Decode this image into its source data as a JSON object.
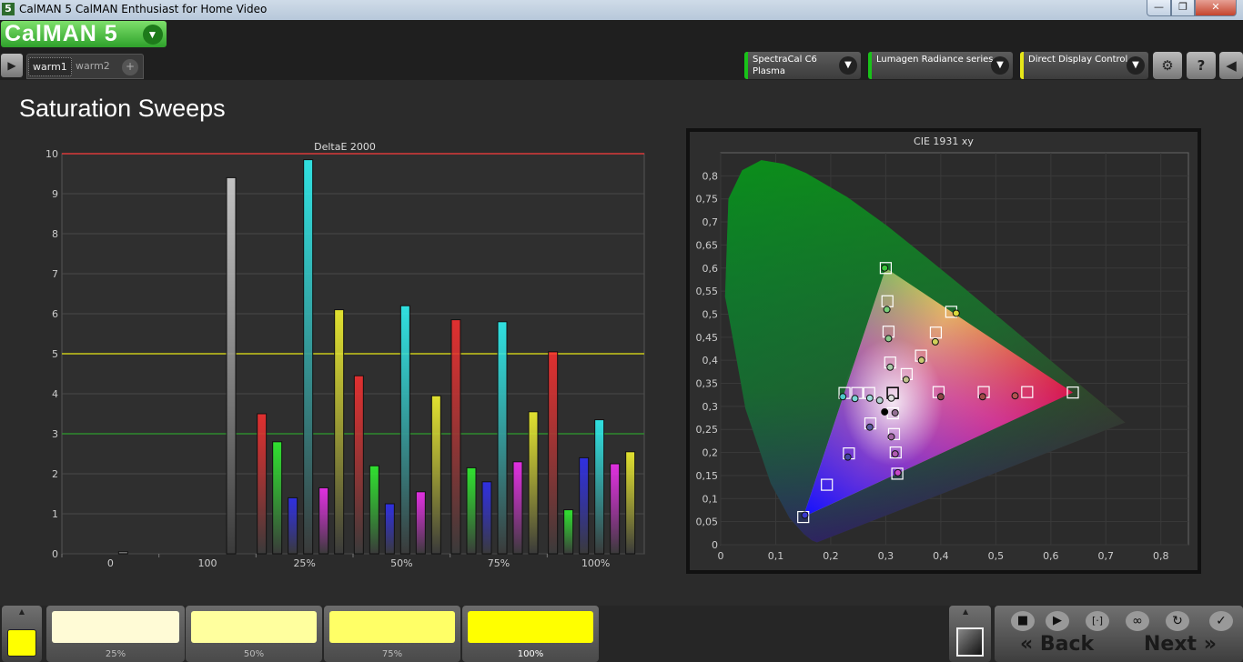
{
  "window": {
    "title": "CalMAN 5 CalMAN Enthusiast for Home Video",
    "minimize": "—",
    "maximize": "❐",
    "close": "✕"
  },
  "app": {
    "logo": "CalMAN 5",
    "tabs": [
      "warm1",
      "warm2"
    ],
    "add_tab": "+"
  },
  "devices": [
    {
      "line1": "SpectraCal C6",
      "line2": "Plasma",
      "color": "#19c219"
    },
    {
      "line1": "Lumagen Radiance series",
      "line2": "",
      "color": "#19c219"
    },
    {
      "line1": "Direct Display Control",
      "line2": "",
      "color": "#e6e619"
    }
  ],
  "toolbar_icons": [
    "gear-icon",
    "help-icon",
    "collapse-icon"
  ],
  "page": {
    "title": "Saturation Sweeps"
  },
  "chart_data": [
    {
      "type": "bar",
      "title": "DeltaE 2000",
      "categories": [
        "0",
        "100",
        "25%",
        "50%",
        "75%",
        "100%"
      ],
      "ylim": [
        0,
        10
      ],
      "yticks": [
        0,
        1,
        2,
        3,
        4,
        5,
        6,
        7,
        8,
        9,
        10
      ],
      "reference_lines": [
        {
          "value": 10,
          "color": "#d93a3a"
        },
        {
          "value": 5,
          "color": "#c8c81a"
        },
        {
          "value": 3,
          "color": "#2e8a2e"
        }
      ],
      "series": [
        {
          "color": "#dcdcdc",
          "values": [
            0.05,
            9.4,
            0,
            0,
            0,
            0
          ]
        },
        {
          "color": "#ff3030",
          "values": [
            0,
            0,
            3.5,
            4.45,
            5.85,
            5.05
          ]
        },
        {
          "color": "#30ff30",
          "values": [
            0,
            0,
            2.8,
            2.2,
            2.15,
            1.1
          ]
        },
        {
          "color": "#3030ff",
          "values": [
            0,
            0,
            1.4,
            1.25,
            1.8,
            2.4
          ]
        },
        {
          "color": "#30ffff",
          "values": [
            0,
            0,
            9.85,
            6.2,
            5.8,
            3.35
          ]
        },
        {
          "color": "#ff30ff",
          "values": [
            0,
            0,
            1.65,
            1.55,
            2.3,
            2.25
          ]
        },
        {
          "color": "#ffff30",
          "values": [
            0,
            0,
            6.1,
            3.95,
            3.55,
            2.55
          ]
        }
      ]
    },
    {
      "type": "scatter",
      "title": "CIE 1931 xy",
      "xlim": [
        0,
        0.85
      ],
      "ylim": [
        0,
        0.85
      ],
      "xticks": [
        "0",
        "0,1",
        "0,2",
        "0,3",
        "0,4",
        "0,5",
        "0,6",
        "0,7",
        "0,8"
      ],
      "yticks": [
        "0",
        "0,05",
        "0,1",
        "0,15",
        "0,2",
        "0,25",
        "0,3",
        "0,35",
        "0,4",
        "0,45",
        "0,5",
        "0,55",
        "0,6",
        "0,65",
        "0,7",
        "0,75",
        "0,8"
      ],
      "gamut": [
        [
          0.64,
          0.33
        ],
        [
          0.3,
          0.6
        ],
        [
          0.15,
          0.06
        ]
      ],
      "white_point": [
        0.3127,
        0.329
      ],
      "targets": [
        [
          0.64,
          0.33
        ],
        [
          0.557,
          0.331
        ],
        [
          0.478,
          0.331
        ],
        [
          0.396,
          0.331
        ],
        [
          0.3,
          0.6
        ],
        [
          0.303,
          0.528
        ],
        [
          0.305,
          0.462
        ],
        [
          0.308,
          0.395
        ],
        [
          0.15,
          0.06
        ],
        [
          0.193,
          0.13
        ],
        [
          0.233,
          0.198
        ],
        [
          0.272,
          0.263
        ],
        [
          0.225,
          0.329
        ],
        [
          0.248,
          0.329
        ],
        [
          0.27,
          0.329
        ],
        [
          0.321,
          0.154
        ],
        [
          0.318,
          0.2
        ],
        [
          0.315,
          0.24
        ],
        [
          0.313,
          0.285
        ],
        [
          0.419,
          0.505
        ],
        [
          0.391,
          0.46
        ],
        [
          0.364,
          0.41
        ],
        [
          0.338,
          0.37
        ]
      ],
      "measured": [
        {
          "x": 0.535,
          "y": 0.323,
          "c": "#b45050"
        },
        {
          "x": 0.476,
          "y": 0.321,
          "c": "#a04848"
        },
        {
          "x": 0.4,
          "y": 0.321,
          "c": "#8c4646"
        },
        {
          "x": 0.298,
          "y": 0.6,
          "c": "#3cc83c"
        },
        {
          "x": 0.302,
          "y": 0.51,
          "c": "#78d078"
        },
        {
          "x": 0.305,
          "y": 0.447,
          "c": "#8cc88c"
        },
        {
          "x": 0.308,
          "y": 0.385,
          "c": "#aacaaa"
        },
        {
          "x": 0.153,
          "y": 0.064,
          "c": "#3a3acc"
        },
        {
          "x": 0.231,
          "y": 0.19,
          "c": "#4646a8"
        },
        {
          "x": 0.271,
          "y": 0.255,
          "c": "#5a5aa0"
        },
        {
          "x": 0.222,
          "y": 0.321,
          "c": "#4ec8c8"
        },
        {
          "x": 0.244,
          "y": 0.317,
          "c": "#7cd6d6"
        },
        {
          "x": 0.271,
          "y": 0.318,
          "c": "#a0dcdc"
        },
        {
          "x": 0.289,
          "y": 0.313,
          "c": "#b4d4d4"
        },
        {
          "x": 0.322,
          "y": 0.156,
          "c": "#c848c8"
        },
        {
          "x": 0.317,
          "y": 0.197,
          "c": "#b05ab0"
        },
        {
          "x": 0.31,
          "y": 0.234,
          "c": "#a064a0"
        },
        {
          "x": 0.317,
          "y": 0.286,
          "c": "#947094"
        },
        {
          "x": 0.428,
          "y": 0.502,
          "c": "#d8d83c"
        },
        {
          "x": 0.39,
          "y": 0.44,
          "c": "#d0d05a"
        },
        {
          "x": 0.365,
          "y": 0.4,
          "c": "#c8c870"
        },
        {
          "x": 0.337,
          "y": 0.358,
          "c": "#c0c08c"
        },
        {
          "x": 0.298,
          "y": 0.288,
          "c": "#000000"
        },
        {
          "x": 0.31,
          "y": 0.318,
          "c": "#dddddd"
        }
      ]
    }
  ],
  "swatches": {
    "current": "#ffff00",
    "steps": [
      {
        "label": "25%",
        "color": "#fffbd6",
        "active": false
      },
      {
        "label": "50%",
        "color": "#ffff9e",
        "active": false
      },
      {
        "label": "75%",
        "color": "#ffff66",
        "active": false
      },
      {
        "label": "100%",
        "color": "#ffff00",
        "active": true
      }
    ]
  },
  "nav": {
    "back": "Back",
    "next": "Next",
    "controls": [
      "stop-icon",
      "play-icon",
      "measure-icon",
      "loop-icon",
      "refresh-icon",
      "check-icon"
    ]
  }
}
